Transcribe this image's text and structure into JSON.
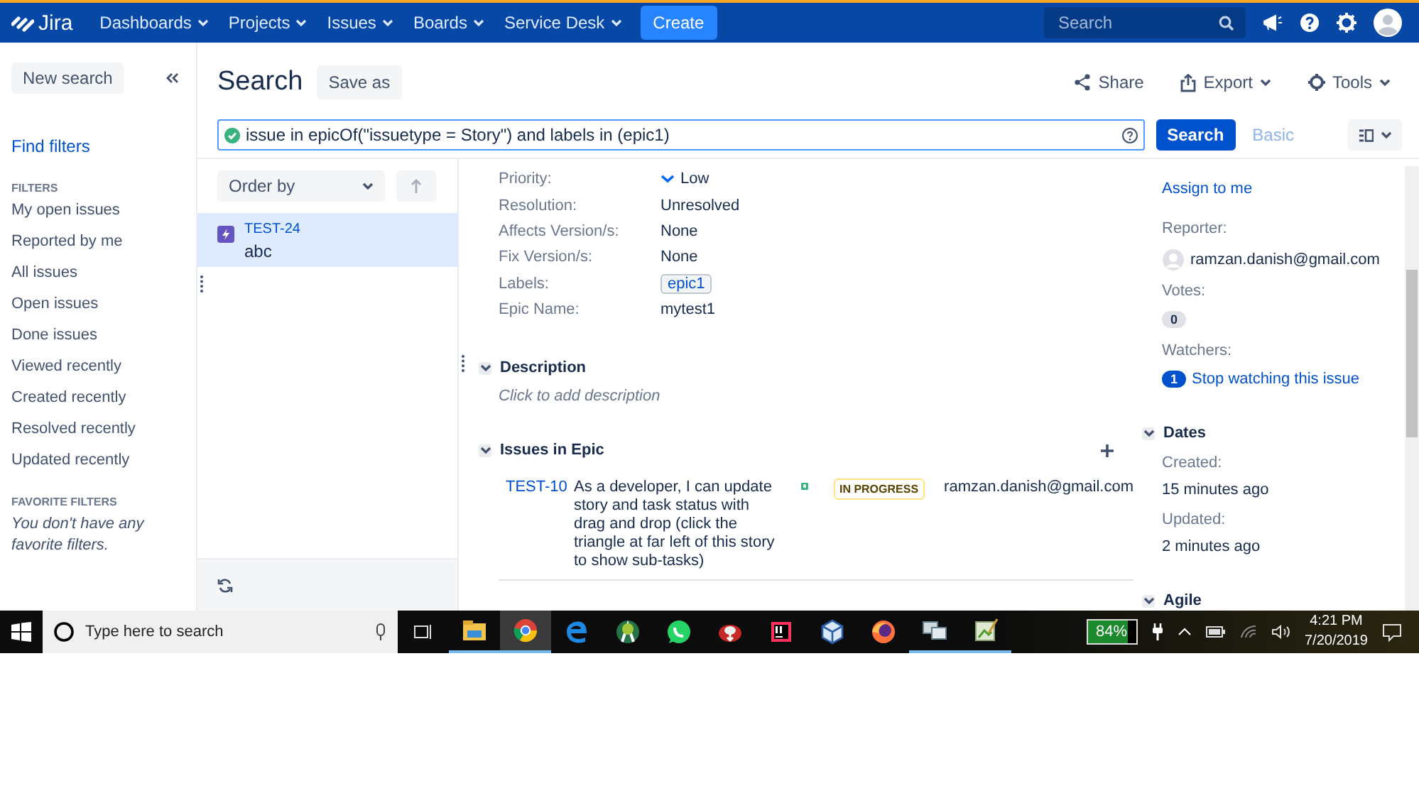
{
  "nav": {
    "logo": "Jira",
    "menus": [
      {
        "label": "Dashboards"
      },
      {
        "label": "Projects"
      },
      {
        "label": "Issues"
      },
      {
        "label": "Boards"
      },
      {
        "label": "Service Desk"
      }
    ],
    "create": "Create",
    "search": {
      "placeholder": "Search"
    }
  },
  "sidebar": {
    "new_search": "New search",
    "find_filters": "Find filters",
    "filters_heading": "FILTERS",
    "filters": [
      "My open issues",
      "Reported by me",
      "All issues",
      "Open issues",
      "Done issues",
      "Viewed recently",
      "Created recently",
      "Resolved recently",
      "Updated recently"
    ],
    "favorites_heading": "FAVORITE FILTERS",
    "favorites_empty": "You don't have any favorite filters."
  },
  "header": {
    "title": "Search",
    "save_as": "Save as",
    "actions": [
      {
        "label": "Share",
        "kind": "share",
        "dropdown": false
      },
      {
        "label": "Export",
        "kind": "export",
        "dropdown": true
      },
      {
        "label": "Tools",
        "kind": "tools",
        "dropdown": true
      }
    ]
  },
  "query": {
    "valid": true,
    "value": "issue in epicOf(\"issuetype = Story\") and labels in (epic1)",
    "search_button": "Search",
    "basic_link": "Basic"
  },
  "list": {
    "order_by": "Order by",
    "issues": [
      {
        "key": "TEST-24",
        "summary": "abc",
        "selected": true
      }
    ]
  },
  "details": {
    "fields": [
      {
        "label": "Priority:",
        "value": "Low",
        "kind": "priority"
      },
      {
        "label": "Resolution:",
        "value": "Unresolved",
        "kind": "text"
      },
      {
        "label": "Affects Version/s:",
        "value": "None",
        "kind": "text"
      },
      {
        "label": "Fix Version/s:",
        "value": "None",
        "kind": "text"
      },
      {
        "label": "Labels:",
        "value": "epic1",
        "kind": "label"
      },
      {
        "label": "Epic Name:",
        "value": "mytest1",
        "kind": "text"
      }
    ],
    "description": {
      "title": "Description",
      "placeholder": "Click to add description",
      "expanded": true
    },
    "issues_in_epic": {
      "title": "Issues in Epic",
      "expanded": true,
      "rows": [
        {
          "key": "TEST-10",
          "summary": "As a developer, I can update story and task status with drag and drop (click the triangle at far left of this story to show sub-tasks)",
          "status": "IN PROGRESS",
          "assignee": "ramzan.danish@gmail.com"
        }
      ]
    },
    "people": {
      "assign_link": "Assign to me",
      "reporter_label": "Reporter:",
      "reporter": "ramzan.danish@gmail.com",
      "votes_label": "Votes:",
      "votes": "0",
      "watchers_label": "Watchers:",
      "watchers": "1",
      "watch_link": "Stop watching this issue"
    },
    "dates": {
      "title": "Dates",
      "expanded": true,
      "items": [
        {
          "label": "Created:",
          "value": "15 minutes ago"
        },
        {
          "label": "Updated:",
          "value": "2 minutes ago"
        }
      ]
    },
    "agile": {
      "title": "Agile",
      "expanded": true
    }
  },
  "taskbar": {
    "search_placeholder": "Type here to search",
    "apps": [
      {
        "kind": "explorer",
        "open": true,
        "selected": false
      },
      {
        "kind": "chrome",
        "open": true,
        "selected": true
      },
      {
        "kind": "edge",
        "open": false,
        "selected": false
      },
      {
        "kind": "android",
        "open": false,
        "selected": false
      },
      {
        "kind": "whatsapp",
        "open": false,
        "selected": false
      },
      {
        "kind": "downloader",
        "open": false,
        "selected": false
      },
      {
        "kind": "intellij",
        "open": false,
        "selected": false
      },
      {
        "kind": "virtualbox",
        "open": false,
        "selected": false
      },
      {
        "kind": "firefox",
        "open": false,
        "selected": false
      },
      {
        "kind": "network",
        "open": true,
        "selected": false
      },
      {
        "kind": "notepad",
        "open": true,
        "selected": false
      }
    ],
    "battery": {
      "reading": "84%",
      "level": 0.84
    },
    "time": "4:21 PM",
    "date": "7/20/2019"
  }
}
